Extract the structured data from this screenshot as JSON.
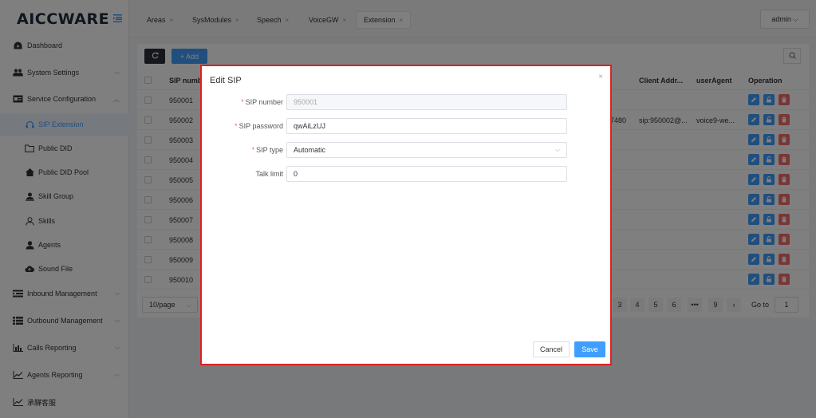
{
  "app": {
    "logo": "AICCWARE"
  },
  "sidebar": {
    "items": [
      {
        "label": "Dashboard",
        "icon": "dashboard-icon"
      },
      {
        "label": "System Settings",
        "icon": "users-icon"
      },
      {
        "label": "Service Configuration",
        "icon": "card-icon"
      },
      {
        "label": "Inbound Management",
        "icon": "inbound-icon"
      },
      {
        "label": "Outbound Management",
        "icon": "list-icon"
      },
      {
        "label": "Calls Reporting",
        "icon": "bar-chart-icon"
      },
      {
        "label": "Agents Reporting",
        "icon": "line-chart-icon"
      },
      {
        "label": "承驊客服",
        "icon": "line-chart-icon"
      }
    ],
    "sub_items": [
      {
        "label": "SIP Extension",
        "icon": "headset-icon"
      },
      {
        "label": "Public DID",
        "icon": "folder-icon"
      },
      {
        "label": "Public DID Pool",
        "icon": "home-icon"
      },
      {
        "label": "Skill Group",
        "icon": "skill-group-icon"
      },
      {
        "label": "Skills",
        "icon": "user-outline-icon"
      },
      {
        "label": "Agents",
        "icon": "user-icon"
      },
      {
        "label": "Sound File",
        "icon": "cloud-icon"
      }
    ]
  },
  "tabs": [
    {
      "label": "Areas"
    },
    {
      "label": "SysModules"
    },
    {
      "label": "Speech"
    },
    {
      "label": "VoiceGW"
    },
    {
      "label": "Extension"
    }
  ],
  "user": {
    "name": "admin"
  },
  "toolbar": {
    "add_label": "+ Add"
  },
  "table": {
    "headers": {
      "sip_number": "SIP numb",
      "client_addr": "Client Addr...",
      "user_agent": "userAgent",
      "operation": "Operation"
    },
    "rows": [
      {
        "sip": "950001"
      },
      {
        "sip": "950002",
        "port": "7480",
        "client": "sip:950002@...",
        "agent": "voice9-we..."
      },
      {
        "sip": "950003"
      },
      {
        "sip": "950004"
      },
      {
        "sip": "950005"
      },
      {
        "sip": "950006"
      },
      {
        "sip": "950007"
      },
      {
        "sip": "950008"
      },
      {
        "sip": "950009"
      },
      {
        "sip": "950010"
      }
    ]
  },
  "pagination": {
    "page_size": "10/page",
    "pages": [
      "3",
      "4",
      "5",
      "6",
      "•••",
      "9"
    ],
    "next": "›",
    "goto_label": "Go to",
    "goto_value": "1"
  },
  "modal": {
    "title": "Edit SIP",
    "close": "×",
    "fields": {
      "sip_number": {
        "label": "SIP number",
        "value": "950001"
      },
      "sip_password": {
        "label": "SIP password",
        "value": "qwAiLzUJ"
      },
      "sip_type": {
        "label": "SIP type",
        "value": "Automatic"
      },
      "talk_limit": {
        "label": "Talk limit",
        "value": "0"
      }
    },
    "required_mark": "*",
    "cancel_label": "Cancel",
    "save_label": "Save"
  },
  "colors": {
    "primary": "#409eff",
    "danger": "#f56c6c",
    "highlight_border": "#e02020"
  }
}
